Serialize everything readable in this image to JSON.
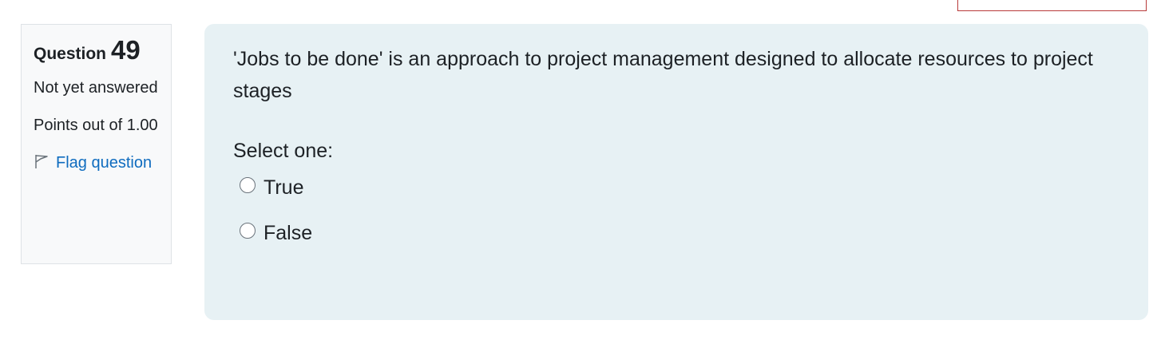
{
  "question_info": {
    "label": "Question",
    "number": "49",
    "state": "Not yet answered",
    "grade": "Points out of 1.00",
    "flag_label": "Flag question"
  },
  "question": {
    "text": "'Jobs to be done' is an approach to project management designed to allocate resources to project stages",
    "prompt": "Select one:",
    "options": [
      {
        "label": "True",
        "selected": false
      },
      {
        "label": "False",
        "selected": false
      }
    ]
  },
  "colors": {
    "link": "#0f6cbf",
    "content_background": "#e7f1f4",
    "info_background": "#f8f9fa"
  },
  "icons": {
    "flag": "flag-icon"
  }
}
